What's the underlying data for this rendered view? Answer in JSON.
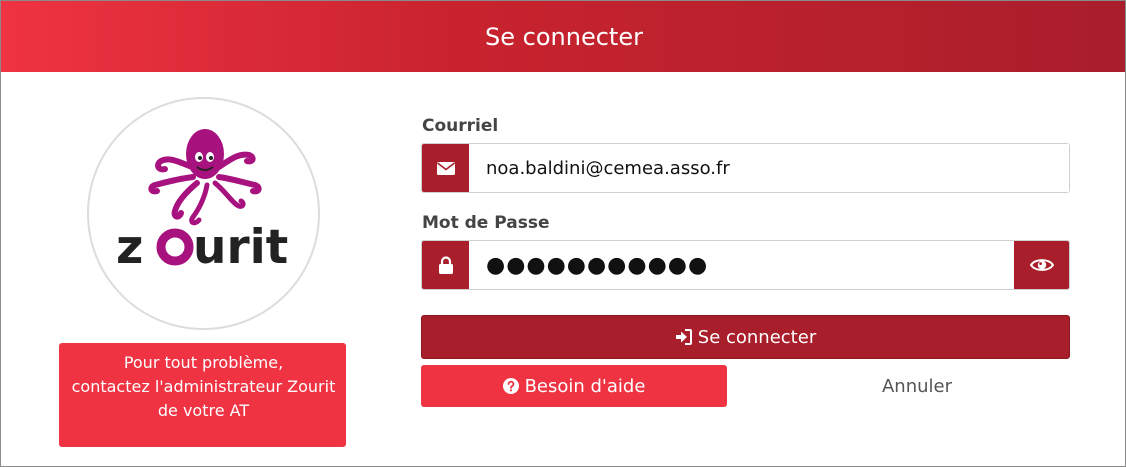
{
  "header": {
    "title": "Se connecter"
  },
  "logo": {
    "text": "zourit",
    "icon": "octopus-logo"
  },
  "help_note": {
    "line1": "Pour tout problème,",
    "line2": "contactez l'administrateur Zourit",
    "line3": "de votre AT"
  },
  "form": {
    "email_label": "Courriel",
    "email_value": "noa.baldini@cemea.asso.fr",
    "email_icon": "envelope-icon",
    "password_label": "Mot de Passe",
    "password_value": "●●●●●●●●●●●",
    "password_icon": "lock-icon",
    "show_password_icon": "eye-icon"
  },
  "buttons": {
    "login_label": "Se connecter",
    "login_icon": "sign-in-icon",
    "help_label": "Besoin d'aide",
    "help_icon": "question-circle-icon",
    "cancel_label": "Annuler"
  },
  "colors": {
    "brand_red": "#ef3342",
    "dark_red": "#a91e2b",
    "logo_purple": "#a7127f"
  }
}
